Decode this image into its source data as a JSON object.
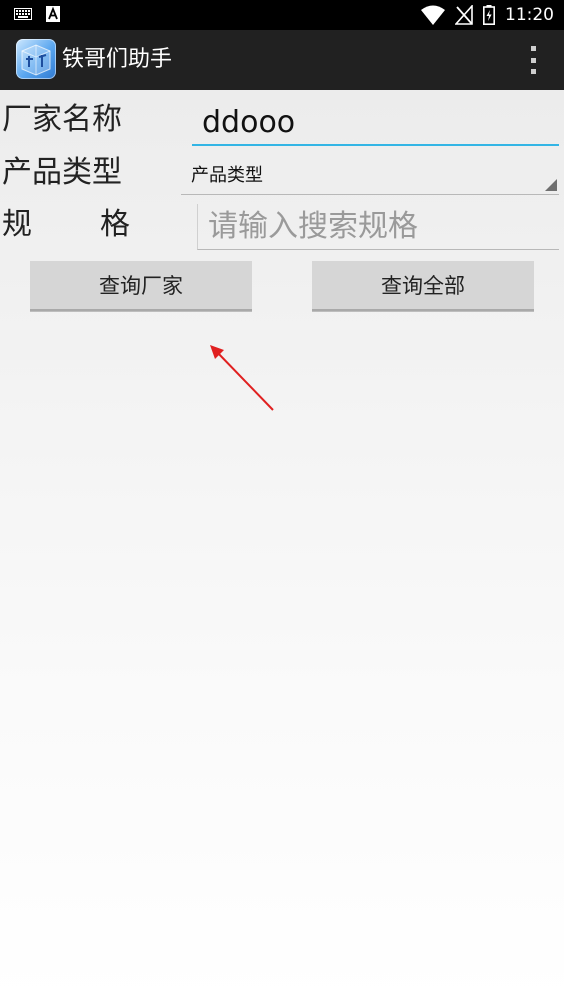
{
  "status_bar": {
    "time": "11:20",
    "left_icons": [
      "keyboard-icon",
      "a-icon"
    ],
    "right_icons": [
      "wifi-icon",
      "no-signal-icon",
      "battery-charging-icon"
    ]
  },
  "app": {
    "title": "铁哥们助手",
    "icon": "app-logo-icon",
    "overflow_icon": "overflow-menu-icon"
  },
  "form": {
    "manufacturer_label": "厂家名称",
    "manufacturer_value": "ddooo",
    "product_type_label": "产品类型",
    "product_type_selected": "产品类型",
    "spec_label_1": "规",
    "spec_label_2": "格",
    "spec_placeholder": "请输入搜索规格"
  },
  "buttons": {
    "query_manufacturer": "查询厂家",
    "query_all": "查询全部"
  },
  "colors": {
    "accent": "#33b5e5",
    "annotation_arrow": "#e02020",
    "action_bar": "#212121"
  }
}
